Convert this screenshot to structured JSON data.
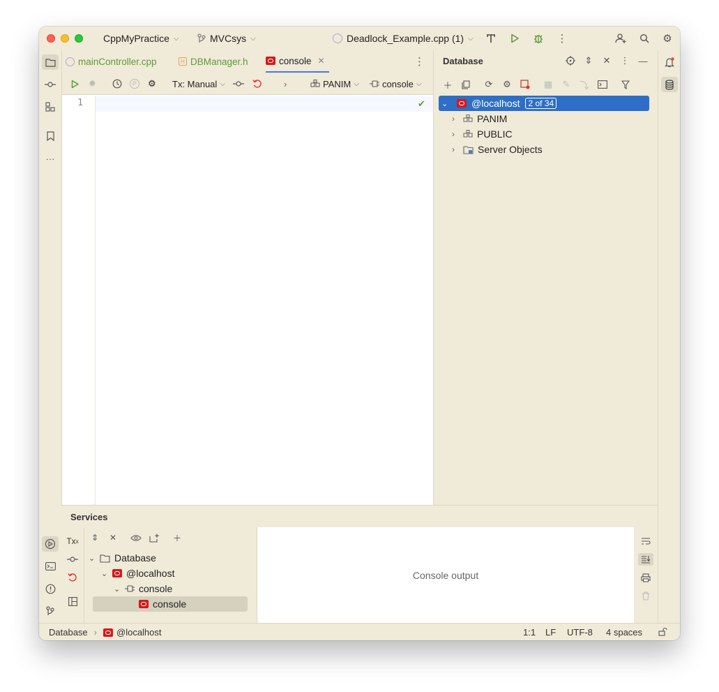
{
  "titlebar": {
    "project": "CppMyPractice",
    "branch": "MVCsys",
    "run_config": "Deadlock_Example.cpp (1)"
  },
  "editor": {
    "tabs": [
      {
        "label": "mainController.cpp"
      },
      {
        "label": "DBManager.h"
      },
      {
        "label": "console"
      }
    ],
    "toolbar": {
      "tx_mode": "Tx: Manual",
      "schema": "PANIM",
      "session": "console"
    },
    "line_number": "1"
  },
  "database": {
    "title": "Database",
    "root": {
      "label": "@localhost",
      "badge": "2 of 34"
    },
    "children": [
      {
        "label": "PANIM"
      },
      {
        "label": "PUBLIC"
      },
      {
        "label": "Server Objects"
      }
    ]
  },
  "services": {
    "title": "Services",
    "tx_label": "Tx",
    "tree": {
      "database": "Database",
      "host": "@localhost",
      "console_group": "console",
      "console_item": "console"
    },
    "output_placeholder": "Console output"
  },
  "statusbar": {
    "breadcrumb_root": "Database",
    "breadcrumb_host": "@localhost",
    "position": "1:1",
    "line_ending": "LF",
    "encoding": "UTF-8",
    "indent": "4 spaces"
  },
  "colors": {
    "accent": "#2f6ec6",
    "oracle_red": "#d31a1a",
    "run_green": "#5d9b3c",
    "chrome_bg": "#f0ead8"
  }
}
